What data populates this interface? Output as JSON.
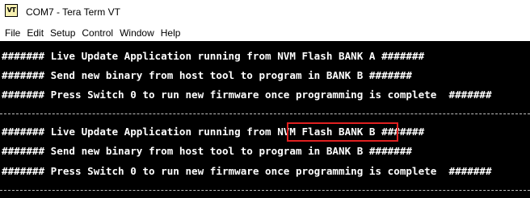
{
  "window": {
    "icon_text": "VT",
    "title": "COM7 - Tera Term VT"
  },
  "menu": {
    "items": [
      "File",
      "Edit",
      "Setup",
      "Control",
      "Window",
      "Help"
    ]
  },
  "terminal": {
    "block1": {
      "line1": "####### Live Update Application running from NVM Flash BANK A #######",
      "line2": "####### Send new binary from host tool to program in BANK B #######",
      "line3": "####### Press Switch 0 to run new firmware once programming is complete  #######"
    },
    "block2": {
      "line1_prefix": "####### Live Update Application running from ",
      "line1_highlight": "NVM Flash BANK B",
      "line1_suffix": " #######",
      "line2": "####### Send new binary from host tool to program in BANK B #######",
      "line3": "####### Press Switch 0 to run new firmware once programming is complete  #######"
    },
    "colors": {
      "background": "#000000",
      "text": "#ffffff",
      "highlight_border": "#e02020"
    }
  }
}
